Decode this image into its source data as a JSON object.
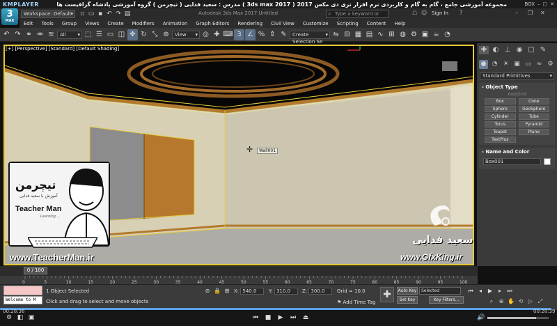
{
  "kmplayer": {
    "logo": "KMPLAYER",
    "title": "مجموعه آموزشی جامع ، گام به گام و کاربردی نرم افزار تری دی مکس 2017 ( 3ds max 2017 ) مدرس : سعید فدایی ( تیچرمن ) گروه آموزشی پادشاه گرافیست ها",
    "right_label": "BOX",
    "time_left": "00:28:36",
    "time_right": "00:28:39",
    "progress_pct": 99
  },
  "app": {
    "logo_number": "3",
    "logo_sub": "MAX",
    "workspace_label": "Workspace: Default",
    "title": "Autodesk 3ds Max 2017      Untitled",
    "search_placeholder": "Type a keyword or phrase",
    "signin_label": "Sign In"
  },
  "menus": [
    "Edit",
    "Tools",
    "Group",
    "Views",
    "Create",
    "Modifiers",
    "Animation",
    "Graph Editors",
    "Rendering",
    "Civil View",
    "Customize",
    "Scripting",
    "Content",
    "Help"
  ],
  "toolbar": {
    "filter_dropdown": "All",
    "refcoord_dropdown": "View",
    "selection_set": "Create Selection Se"
  },
  "viewport": {
    "label_plus": "[+]",
    "label_view": "[Perspective]",
    "label_style": "[Standard]",
    "label_shading": "[Default Shading]",
    "tooltip": "Wall001"
  },
  "command_panel": {
    "category": "Standard Primitives",
    "object_type_title": "Object Type",
    "autogrid": "AutoGrid",
    "primitives": [
      "Box",
      "Cone",
      "Sphere",
      "GeoSphere",
      "Cylinder",
      "Tube",
      "Torus",
      "Pyramid",
      "Teapot",
      "Plane",
      "TextPlus"
    ],
    "name_color_title": "Name and Color",
    "object_name": "Box001",
    "object_color": "#ffffff"
  },
  "timeline": {
    "frame_label": "0 / 100",
    "ticks": [
      "0",
      "5",
      "10",
      "15",
      "20",
      "25",
      "30",
      "35",
      "40",
      "45",
      "50",
      "55",
      "60",
      "65",
      "70",
      "75",
      "80",
      "85",
      "90",
      "95",
      "100"
    ]
  },
  "status": {
    "welcome": "Welcome to M",
    "selection": "1 Object Selected",
    "prompt": "Click and drag to select and move objects",
    "x_label": "X:",
    "x_value": "540.0",
    "y_label": "Y:",
    "y_value": "310.0",
    "z_label": "Z:",
    "z_value": "300.0",
    "grid": "Grid = 10.0",
    "add_time_tag": "Add Time Tag",
    "auto_key": "Auto Key",
    "set_key": "Set Key",
    "selected": "Selected",
    "key_filters": "Key Filters..."
  },
  "overlays": {
    "teacher_brand_fa": "تیچرمن",
    "teacher_tagline_fa": "آموزش با سعید فدایی",
    "teacher_brand_en": "Teacher Man",
    "teacher_slogan": "Learning ...",
    "teacher_url": "www.TeacherMan.ir",
    "gfx_name_fa": "سعید فدایی",
    "gfx_url": "www.GfxKing.ir"
  },
  "colors": {
    "accent": "#e6c93a",
    "ceiling": "#060606",
    "wall": "#d8d1b8",
    "floor": "#b0aea8",
    "trim": "#b27a2c",
    "door": "#b5782c"
  }
}
